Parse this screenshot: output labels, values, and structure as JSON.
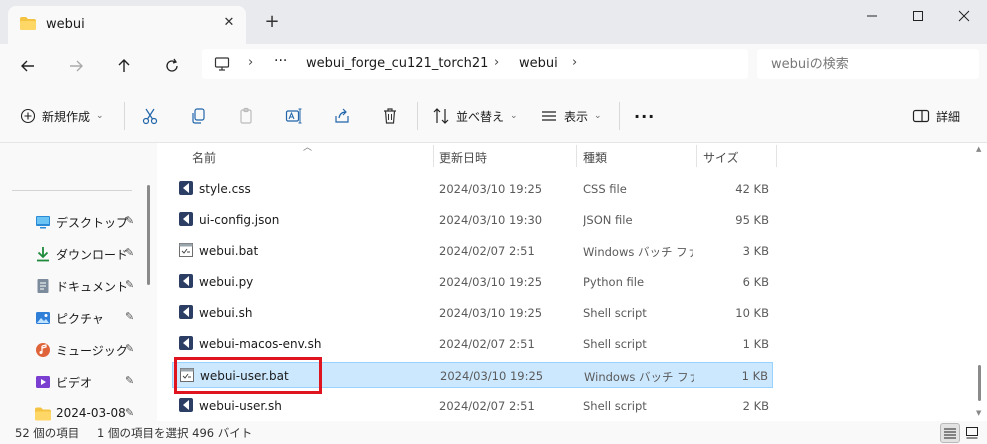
{
  "window": {
    "tab_title": "webui",
    "new_tab": "+",
    "close": "✕"
  },
  "address": {
    "ellipsis": "···",
    "crumbs": [
      "webui_forge_cu121_torch21",
      "webui"
    ],
    "search_placeholder": "webuiの検索"
  },
  "toolbar": {
    "new_label": "新規作成",
    "sort_label": "並べ替え",
    "view_label": "表示",
    "more": "···",
    "details_label": "詳細"
  },
  "sidebar": {
    "items": [
      {
        "label": "デスクトップ",
        "icon": "desktop-icon",
        "color": "#2b8ad6"
      },
      {
        "label": "ダウンロード",
        "icon": "download-icon",
        "color": "#1f8a3c"
      },
      {
        "label": "ドキュメント",
        "icon": "document-icon",
        "color": "#6b7b8c"
      },
      {
        "label": "ピクチャ",
        "icon": "pictures-icon",
        "color": "#2f7fd8"
      },
      {
        "label": "ミュージック",
        "icon": "music-icon",
        "color": "#e0643a"
      },
      {
        "label": "ビデオ",
        "icon": "video-icon",
        "color": "#7a3fd0"
      },
      {
        "label": "2024-03-08",
        "icon": "folder-icon",
        "color": "#f5c342"
      }
    ],
    "pin": "📌"
  },
  "columns": {
    "name": "名前",
    "modified": "更新日時",
    "type": "種類",
    "size": "サイズ"
  },
  "files": [
    {
      "name": "style.css",
      "date": "2024/03/10 19:25",
      "type": "CSS file",
      "size": "42 KB",
      "icon": "vscode-file-icon"
    },
    {
      "name": "ui-config.json",
      "date": "2024/03/10 19:30",
      "type": "JSON file",
      "size": "95 KB",
      "icon": "vscode-file-icon"
    },
    {
      "name": "webui.bat",
      "date": "2024/02/07 2:51",
      "type": "Windows バッチ ファ...",
      "size": "3 KB",
      "icon": "batch-file-icon"
    },
    {
      "name": "webui.py",
      "date": "2024/03/10 19:25",
      "type": "Python file",
      "size": "6 KB",
      "icon": "vscode-file-icon"
    },
    {
      "name": "webui.sh",
      "date": "2024/03/10 19:25",
      "type": "Shell script",
      "size": "10 KB",
      "icon": "vscode-file-icon"
    },
    {
      "name": "webui-macos-env.sh",
      "date": "2024/02/07 2:51",
      "type": "Shell script",
      "size": "1 KB",
      "icon": "vscode-file-icon"
    },
    {
      "name": "webui-user.bat",
      "date": "2024/03/10 19:25",
      "type": "Windows バッチ ファ...",
      "size": "1 KB",
      "icon": "batch-file-icon",
      "selected": true
    },
    {
      "name": "webui-user.sh",
      "date": "2024/02/07 2:51",
      "type": "Shell script",
      "size": "2 KB",
      "icon": "vscode-file-icon"
    }
  ],
  "status": {
    "count": "52 個の項目",
    "selection": "1 個の項目を選択 496 バイト"
  },
  "colors": {
    "selection_bg": "#cce8ff",
    "highlight": "#e0141e",
    "folder": "#f5c342"
  }
}
